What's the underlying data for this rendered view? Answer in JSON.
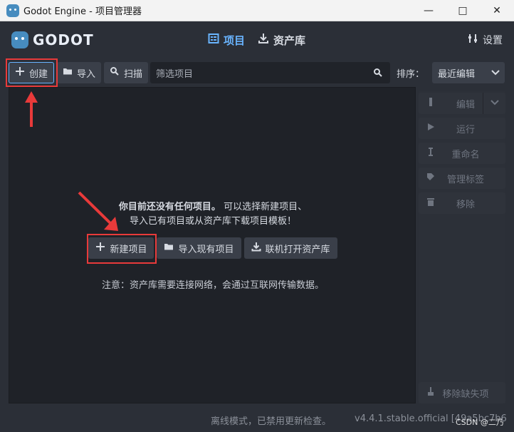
{
  "window": {
    "title": "Godot Engine - 项目管理器",
    "controls": {
      "minimize": "—",
      "maximize": "□",
      "close": "✕"
    }
  },
  "header": {
    "logo_text": "GODOT",
    "tabs": [
      {
        "label": "项目",
        "active": true,
        "icon": "projects-icon"
      },
      {
        "label": "资产库",
        "active": false,
        "icon": "download-icon"
      }
    ],
    "settings_label": "设置"
  },
  "toolbar": {
    "create_label": "创建",
    "import_label": "导入",
    "scan_label": "扫描",
    "filter_placeholder": "筛选项目",
    "sort_label": "排序：",
    "sort_value": "最近编辑"
  },
  "main": {
    "empty_line1_bold": "你目前还没有任何项目。",
    "empty_line1_rest": "可以选择新建项目、",
    "empty_line2": "导入已有项目或从资产库下载项目模板！",
    "buttons": {
      "new_project": "新建项目",
      "import_existing": "导入现有项目",
      "open_asset_lib": "联机打开资产库"
    },
    "note": "注意：资产库需要连接网络，会通过互联网传输数据。"
  },
  "sidebar": {
    "items": [
      {
        "label": "编辑",
        "icon": "edit-icon"
      },
      {
        "label": "运行",
        "icon": "play-icon"
      },
      {
        "label": "重命名",
        "icon": "rename-icon"
      },
      {
        "label": "管理标签",
        "icon": "tag-icon"
      },
      {
        "label": "移除",
        "icon": "trash-icon"
      }
    ],
    "remove_missing": "移除缺失项"
  },
  "status": {
    "offline": "离线模式，已禁用更新检查。",
    "version": "v4.4.1.stable.official [49a5bc7b6"
  },
  "watermark": "CSDN @二乃"
}
